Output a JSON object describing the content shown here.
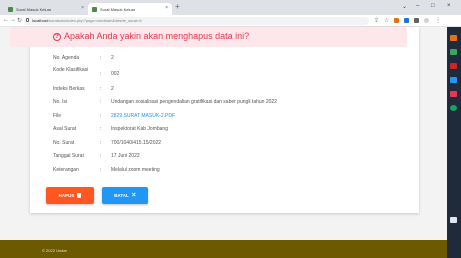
{
  "browser": {
    "tabs": [
      {
        "title": "Surat Masuk Keluar",
        "active": false
      },
      {
        "title": "Surat Masuk Keluar",
        "active": true
      }
    ],
    "url_host": "localhost",
    "url_path": "/suratsolo/index.php?page=smdbam&delete_surat=5"
  },
  "alert": {
    "icon": "question-circle-icon",
    "text": "Apakah Anda yakin akan menghapus data ini?",
    "color": "#e53950"
  },
  "fields": [
    {
      "label": "No. Agenda",
      "value": "2"
    },
    {
      "label": "Kode Klasifikasi",
      "value": "002"
    },
    {
      "label": "Indeks Berkas",
      "value": "2"
    },
    {
      "label": "No. Isi",
      "value": "Undangan sosialisasi pengendalian gratifikasi dan saber pungli tahun 2022"
    },
    {
      "label": "File",
      "value": "2829.SURAT MASUK-2.PDF",
      "link": true
    },
    {
      "label": "Asal Surat",
      "value": "Inspektorat Kab Jombang"
    },
    {
      "label": "No. Surat",
      "value": "700/1040/415.15/2022"
    },
    {
      "label": "Tanggal Surat",
      "value": "17 Juni 2022"
    },
    {
      "label": "Keterangan",
      "value": "Melalui zoom meeting"
    }
  ],
  "buttons": {
    "hapus": {
      "label": "HAPUS",
      "color": "#ff5722"
    },
    "batal": {
      "label": "BATAL",
      "color": "#2196f3"
    }
  },
  "footer": {
    "text": "© 2022 Undar"
  }
}
